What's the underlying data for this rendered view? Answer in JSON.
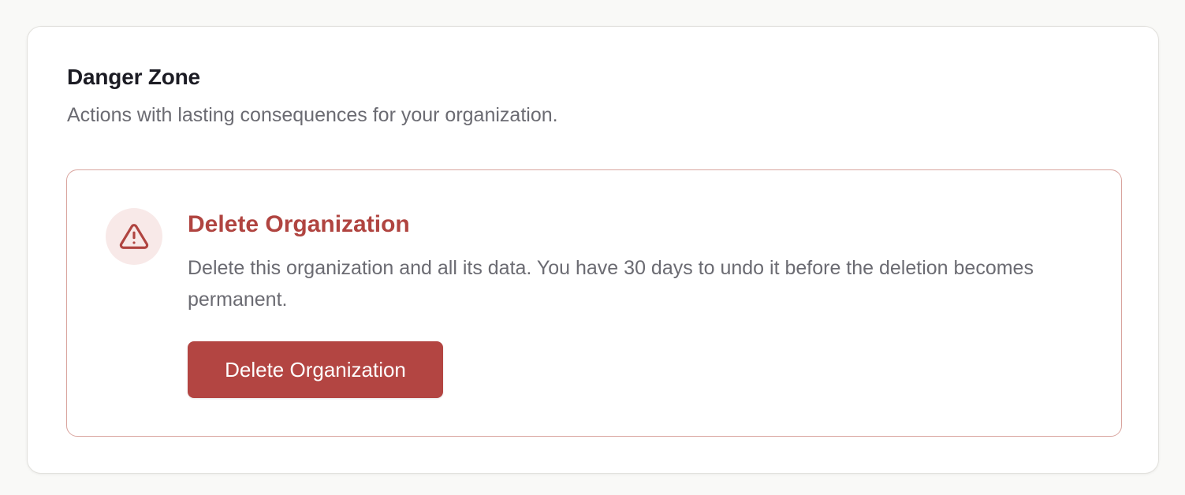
{
  "danger_zone": {
    "title": "Danger Zone",
    "description": "Actions with lasting consequences for your organization."
  },
  "delete_org": {
    "icon": "warning-triangle-icon",
    "title": "Delete Organization",
    "description": "Delete this organization and all its data. You have 30 days to undo it before the deletion becomes permanent.",
    "button_label": "Delete Organization"
  },
  "colors": {
    "danger": "#b34542",
    "danger_border": "#d9a49e",
    "icon_bg": "#f8e9e8"
  }
}
